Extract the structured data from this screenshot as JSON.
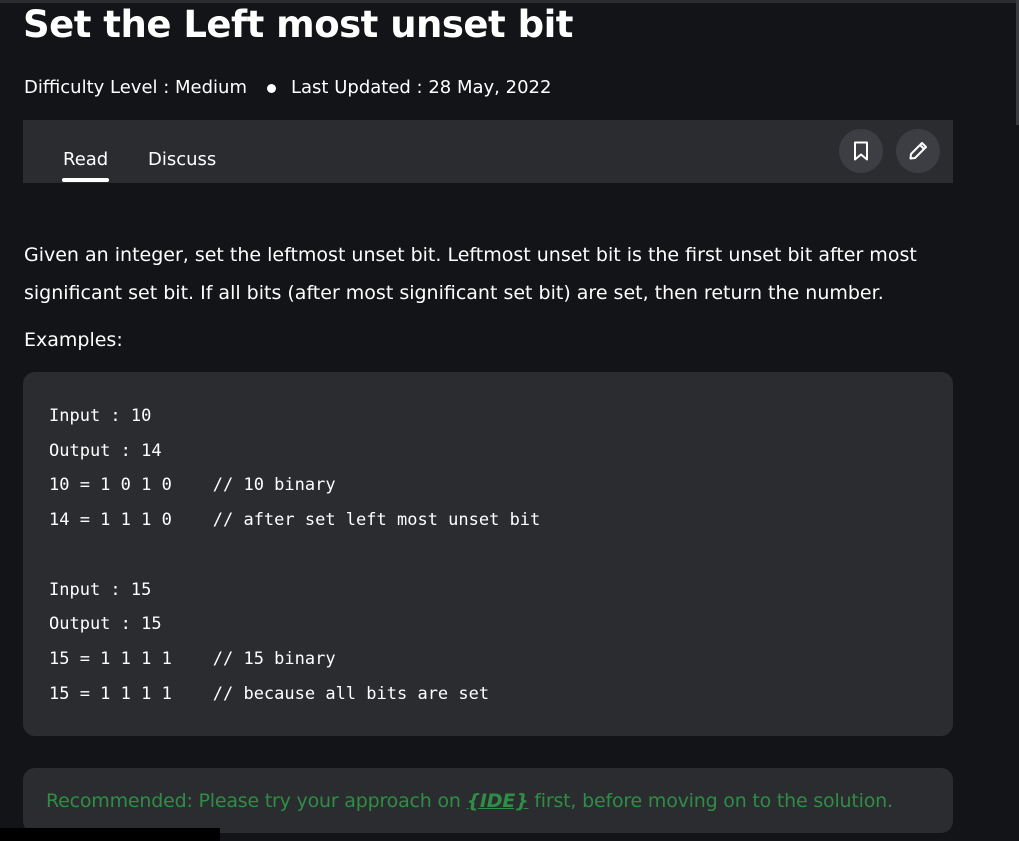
{
  "article": {
    "title": "Set the Left most unset bit",
    "difficulty": "Difficulty Level : Medium",
    "last_updated": "Last Updated : 28 May, 2022"
  },
  "tabs": [
    {
      "label": "Read",
      "active": true
    },
    {
      "label": "Discuss",
      "active": false
    }
  ],
  "actions": {
    "bookmark_icon": "bookmark-icon",
    "edit_icon": "pencil-icon"
  },
  "content": {
    "description": "Given an integer, set the leftmost unset bit. Leftmost unset bit is the first unset bit after most significant set bit. If all bits (after most significant set bit) are set, then return the number.",
    "examples_label": "Examples:",
    "code": "Input : 10\nOutput : 14\n10 = 1 0 1 0    // 10 binary\n14 = 1 1 1 0    // after set left most unset bit\n\nInput : 15\nOutput : 15\n15 = 1 1 1 1    // 15 binary\n15 = 1 1 1 1    // because all bits are set"
  },
  "recommendation": {
    "prefix": "Recommended: Please try your approach on ",
    "link": "{IDE}",
    "suffix": " first, before moving on to the solution."
  },
  "colors": {
    "background": "#131417",
    "panel": "#2b2c30",
    "accent_green": "#2f8d46"
  }
}
